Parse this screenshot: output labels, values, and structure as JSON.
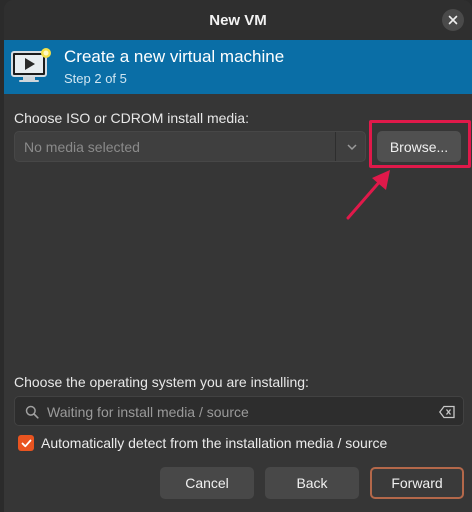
{
  "window": {
    "title": "New VM"
  },
  "banner": {
    "title": "Create a new virtual machine",
    "step": "Step 2 of 5"
  },
  "media": {
    "label": "Choose ISO or CDROM install media:",
    "selected": "No media selected",
    "browse_label": "Browse..."
  },
  "os": {
    "label": "Choose the operating system you are installing:",
    "search_placeholder": "Waiting for install media / source",
    "auto_detect_label": "Automatically detect from the installation media / source",
    "auto_detect_checked": true
  },
  "footer": {
    "cancel_label": "Cancel",
    "back_label": "Back",
    "forward_label": "Forward"
  },
  "colors": {
    "banner": "#0a6ea6",
    "accent": "#e95420",
    "highlight": "#e0194a"
  },
  "icons": {
    "close": "close-icon",
    "vm": "vm-monitor-icon",
    "combo_arrow": "chevron-down-icon",
    "search": "search-icon",
    "clear": "clear-icon",
    "check": "check-icon",
    "annotation_arrow": "arrow-icon"
  }
}
